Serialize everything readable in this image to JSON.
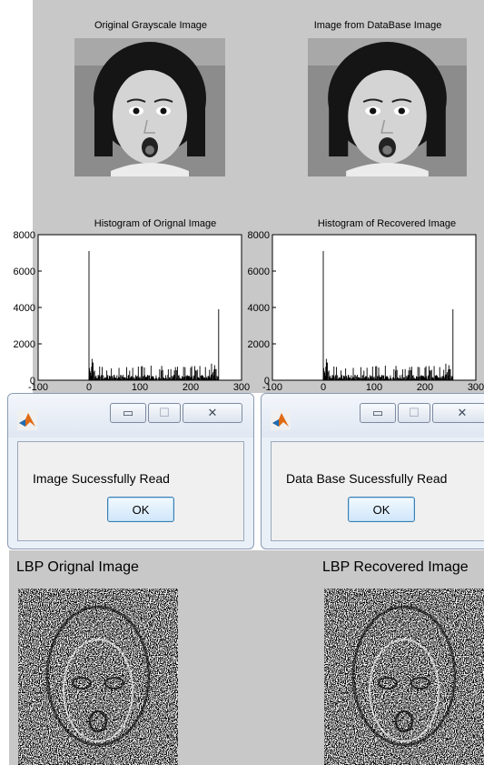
{
  "figure": {
    "top_left_title": "Original Grayscale Image",
    "top_right_title": "Image from DataBase Image",
    "hist_left_title": "Histogram of Orignal Image",
    "hist_right_title": "Histogram of Recovered  Image",
    "y_ticks": [
      "8000",
      "6000",
      "4000",
      "2000",
      "0"
    ],
    "x_ticks": [
      "-100",
      "0",
      "100",
      "200",
      "300"
    ],
    "y_max": 8000,
    "x_range": [
      -100,
      300
    ],
    "histogram": {
      "spike_low": {
        "x": 0,
        "count": 7100
      },
      "spike_high": {
        "x": 255,
        "count": 3900
      }
    }
  },
  "dialog_image": {
    "message": "Image Sucessfully Read",
    "ok_label": "OK",
    "minimize_glyph": "▭",
    "maximize_glyph": "☐",
    "close_glyph": "✕",
    "icon": "matlab-icon"
  },
  "dialog_database": {
    "message": "Data Base Sucessfully Read",
    "ok_label": "OK",
    "minimize_glyph": "▭",
    "maximize_glyph": "☐",
    "close_glyph": "✕",
    "icon": "matlab-icon"
  },
  "lbp": {
    "left_title": "LBP Orignal  Image",
    "right_title": "LBP Recovered Image"
  },
  "colors": {
    "figure_bg": "#c8c8c8",
    "dialog_frame": "#eaf0f8",
    "ok_border": "#3c7fb1"
  }
}
